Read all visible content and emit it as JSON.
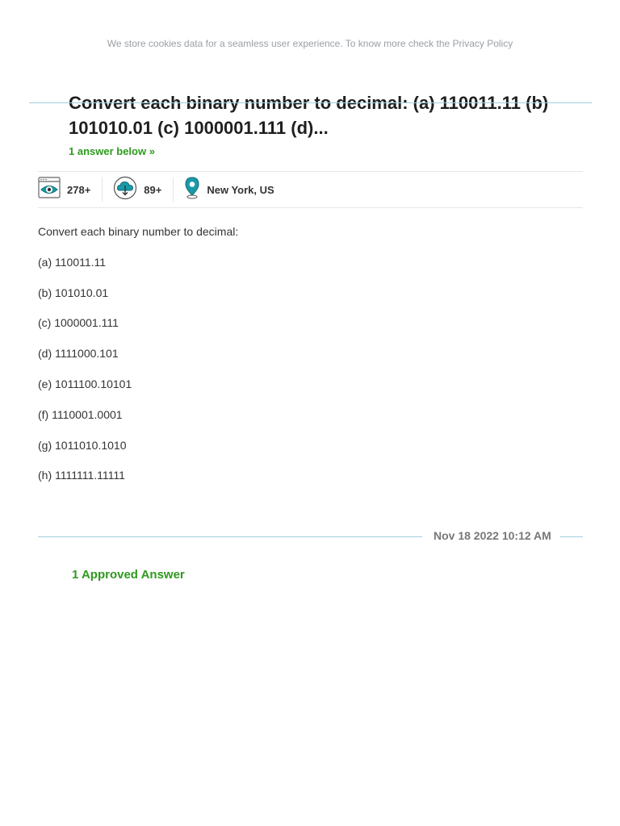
{
  "cookie_banner": {
    "text_prefix": "We store cookies data for a seamless user experience. To know more check the ",
    "link_label": "Privacy Policy"
  },
  "question": {
    "title": "Convert each binary number to decimal: (a) 110011.11 (b) 101010.01 (c) 1000001.111 (d)...",
    "answers_link": "1 answer below »",
    "intro": "Convert each binary number to decimal:",
    "items": [
      "(a) 110011.11",
      "(b) 101010.01",
      "(c) 1000001.111",
      "(d) 1111000.101",
      "(e) 1011100.10101",
      "(f) 1110001.0001",
      "(g) 1011010.1010",
      "(h) 1111111.11111"
    ]
  },
  "stats": {
    "views": "278+",
    "views_icon": "eye-browser-icon",
    "downloads": "89+",
    "downloads_icon": "cloud-download-icon",
    "location": "New York, US",
    "location_icon": "map-pin-icon"
  },
  "timestamp": "Nov 18 2022 10:12 AM",
  "approved_answers": "1 Approved Answer",
  "colors": {
    "accent_green": "#2e9a1e",
    "teal": "#1a9aa8",
    "divider_blue": "#9fd0dd"
  }
}
